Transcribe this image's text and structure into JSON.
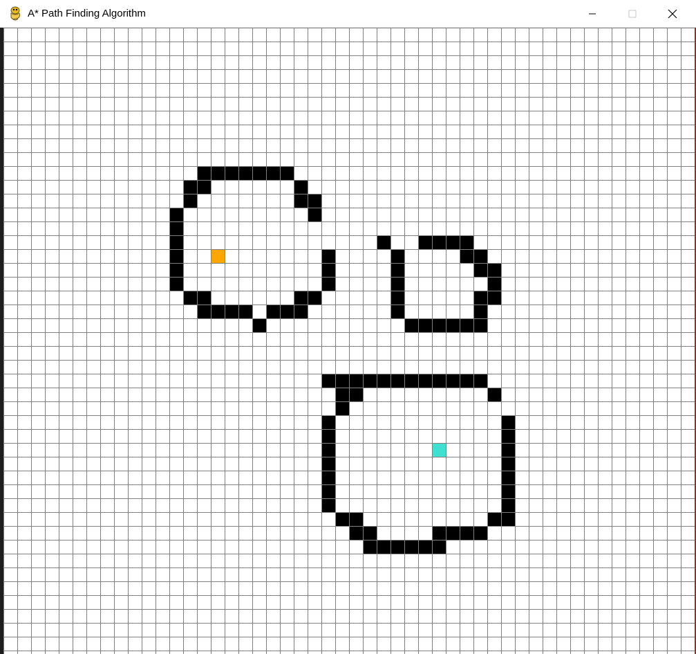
{
  "window": {
    "title": "A* Path Finding Algorithm",
    "icon": "python-snake-icon",
    "controls": {
      "minimize_icon": "minimize-icon",
      "maximize_icon": "maximize-icon",
      "close_icon": "close-icon"
    }
  },
  "grid": {
    "cell_color_empty": "#ffffff",
    "cell_color_barrier": "#000000",
    "grid_line_color": "#808080",
    "start_color": "#ffa500",
    "end_color": "#40e0d0",
    "start": [
      15,
      16
    ],
    "end": [
      31,
      30
    ],
    "barriers": [
      [
        14,
        10
      ],
      [
        15,
        10
      ],
      [
        16,
        10
      ],
      [
        17,
        10
      ],
      [
        18,
        10
      ],
      [
        19,
        10
      ],
      [
        20,
        10
      ],
      [
        13,
        11
      ],
      [
        14,
        11
      ],
      [
        21,
        11
      ],
      [
        13,
        12
      ],
      [
        21,
        12
      ],
      [
        22,
        12
      ],
      [
        12,
        13
      ],
      [
        22,
        13
      ],
      [
        12,
        14
      ],
      [
        12,
        15
      ],
      [
        12,
        16
      ],
      [
        23,
        16
      ],
      [
        12,
        17
      ],
      [
        23,
        17
      ],
      [
        12,
        18
      ],
      [
        23,
        18
      ],
      [
        13,
        19
      ],
      [
        14,
        19
      ],
      [
        21,
        19
      ],
      [
        22,
        19
      ],
      [
        14,
        20
      ],
      [
        15,
        20
      ],
      [
        16,
        20
      ],
      [
        17,
        20
      ],
      [
        19,
        20
      ],
      [
        20,
        20
      ],
      [
        21,
        20
      ],
      [
        18,
        21
      ],
      [
        27,
        15
      ],
      [
        30,
        15
      ],
      [
        31,
        15
      ],
      [
        32,
        15
      ],
      [
        33,
        15
      ],
      [
        28,
        16
      ],
      [
        33,
        16
      ],
      [
        34,
        16
      ],
      [
        28,
        17
      ],
      [
        34,
        17
      ],
      [
        35,
        17
      ],
      [
        28,
        18
      ],
      [
        35,
        18
      ],
      [
        28,
        19
      ],
      [
        34,
        19
      ],
      [
        35,
        19
      ],
      [
        28,
        20
      ],
      [
        34,
        20
      ],
      [
        29,
        21
      ],
      [
        30,
        21
      ],
      [
        31,
        21
      ],
      [
        32,
        21
      ],
      [
        33,
        21
      ],
      [
        34,
        21
      ],
      [
        23,
        25
      ],
      [
        24,
        25
      ],
      [
        25,
        25
      ],
      [
        26,
        25
      ],
      [
        27,
        25
      ],
      [
        28,
        25
      ],
      [
        29,
        25
      ],
      [
        30,
        25
      ],
      [
        31,
        25
      ],
      [
        32,
        25
      ],
      [
        33,
        25
      ],
      [
        34,
        25
      ],
      [
        24,
        26
      ],
      [
        25,
        26
      ],
      [
        35,
        26
      ],
      [
        24,
        27
      ],
      [
        23,
        28
      ],
      [
        36,
        28
      ],
      [
        23,
        29
      ],
      [
        36,
        29
      ],
      [
        23,
        30
      ],
      [
        36,
        30
      ],
      [
        23,
        31
      ],
      [
        36,
        31
      ],
      [
        23,
        32
      ],
      [
        36,
        32
      ],
      [
        23,
        33
      ],
      [
        36,
        33
      ],
      [
        23,
        34
      ],
      [
        36,
        34
      ],
      [
        24,
        35
      ],
      [
        25,
        35
      ],
      [
        35,
        35
      ],
      [
        36,
        35
      ],
      [
        25,
        36
      ],
      [
        26,
        36
      ],
      [
        31,
        36
      ],
      [
        32,
        36
      ],
      [
        33,
        36
      ],
      [
        34,
        36
      ],
      [
        26,
        37
      ],
      [
        27,
        37
      ],
      [
        28,
        37
      ],
      [
        29,
        37
      ],
      [
        30,
        37
      ],
      [
        31,
        37
      ]
    ]
  }
}
